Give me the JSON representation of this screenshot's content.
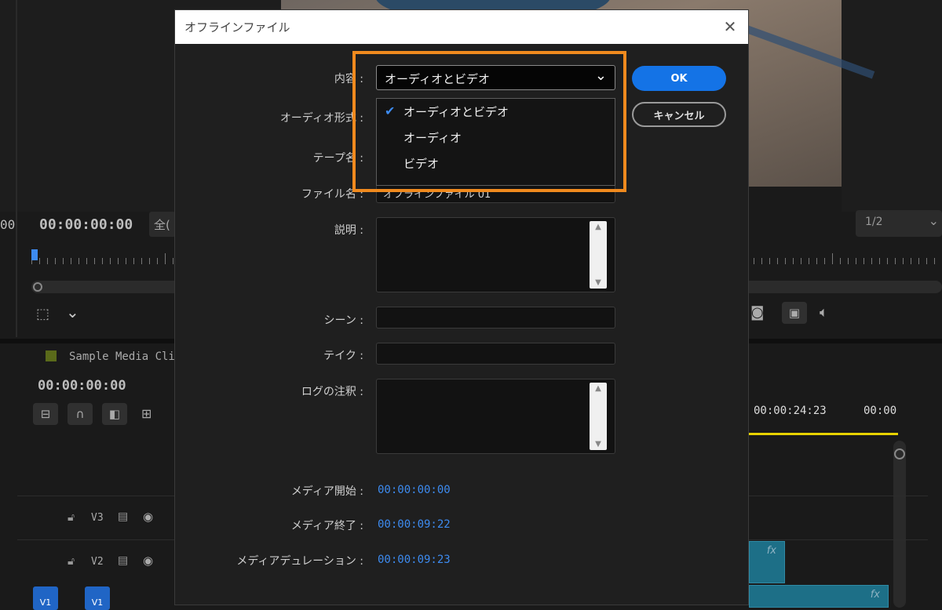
{
  "background": {
    "program_timecode": "00:00:00:00",
    "left_edge_label": "00",
    "fit_dropdown_label": "全(",
    "resolution_label": "1/2",
    "sequence_name": "Sample Media Cli",
    "sequence_timecode": "00:00:00:00",
    "ruler_timecode_1": "00:00:24:23",
    "ruler_timecode_2": "00:00",
    "tracks": [
      {
        "label": "V3"
      },
      {
        "label": "V2"
      },
      {
        "label": "V1"
      }
    ],
    "fx_label": "fx"
  },
  "dialog": {
    "title": "オフラインファイル",
    "labels": {
      "contents": "内容 :",
      "audio_format": "オーディオ形式 :",
      "tape_name": "テープ名 :",
      "file_name": "ファイル名 :",
      "description": "説明 :",
      "scene": "シーン :",
      "take": "テイク :",
      "log_note": "ログの注釈 :",
      "media_start": "メディア開始 :",
      "media_end": "メディア終了 :",
      "media_duration": "メディアデュレーション :"
    },
    "contents_selected": "オーディオとビデオ",
    "dropdown_options": [
      {
        "label": "オーディオとビデオ",
        "checked": true
      },
      {
        "label": "オーディオ",
        "checked": false
      },
      {
        "label": "ビデオ",
        "checked": false
      }
    ],
    "file_name_value": "オフラインファイル 01",
    "media_start_value": "00:00:00:00",
    "media_end_value": "00:00:09:22",
    "media_duration_value": "00:00:09:23",
    "ok_label": "OK",
    "cancel_label": "キャンセル",
    "highlight_color": "#f08a1e",
    "accent_color": "#1473e6"
  }
}
